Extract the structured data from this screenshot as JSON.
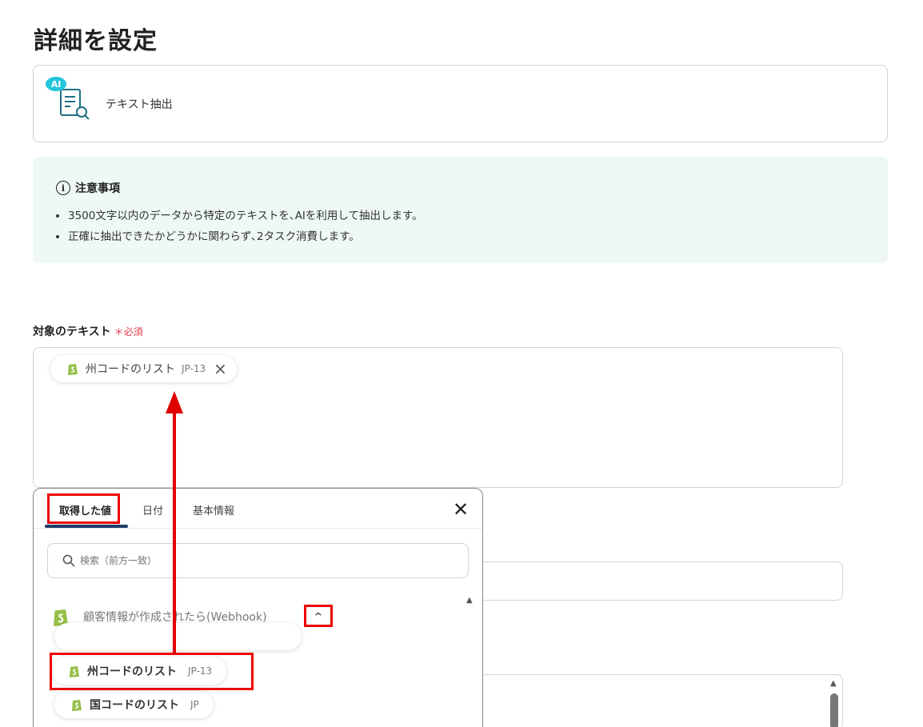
{
  "page": {
    "title": "詳細を設定"
  },
  "operation": {
    "badge": "AI",
    "label": "テキスト抽出"
  },
  "notice": {
    "title": "注意事項",
    "items": [
      "3500文字以内のデータから特定のテキストを､AIを利用して抽出します。",
      "正確に抽出できたかどうかに関わらず､2タスク消費します。"
    ]
  },
  "field": {
    "label": "対象のテキスト",
    "required": "＊必須"
  },
  "selected_chip": {
    "label": "州コードのリスト",
    "code": "JP-13"
  },
  "popup": {
    "tabs": [
      {
        "label": "取得した値",
        "active": true
      },
      {
        "label": "日付",
        "active": false
      },
      {
        "label": "基本情報",
        "active": false
      }
    ],
    "search_placeholder": "検索（前方一致）",
    "group_label": "顧客情報が作成されたら(Webhook)",
    "items": [
      {
        "label": "州コードのリスト",
        "code": "JP-13"
      },
      {
        "label": "国コードのリスト",
        "code": "JP"
      }
    ]
  },
  "colors": {
    "highlight": "#e00000",
    "accent_tab": "#1f3d6b",
    "shopify": "#95bf47",
    "required": "#e33b49"
  }
}
